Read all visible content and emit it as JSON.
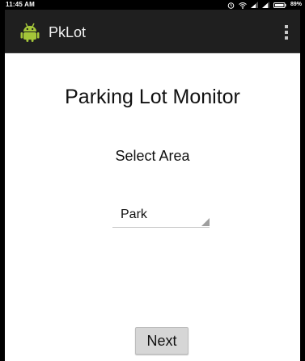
{
  "status_bar": {
    "time": "11:45 AM",
    "battery_percent": "89%",
    "icons": [
      "alarm-icon",
      "wifi-icon",
      "signal-icon",
      "signal-icon",
      "battery-icon"
    ]
  },
  "action_bar": {
    "app_name": "PkLot",
    "icon": "android-icon",
    "menu_icon": "overflow-menu-icon"
  },
  "main": {
    "title": "Parking Lot Monitor",
    "select_label": "Select Area",
    "spinner": {
      "selected_value": "Park"
    },
    "next_button_label": "Next"
  },
  "colors": {
    "status_bar_bg": "#000000",
    "action_bar_bg": "#1f1f1f",
    "android_green": "#a4c639",
    "button_bg": "#d6d6d6"
  }
}
